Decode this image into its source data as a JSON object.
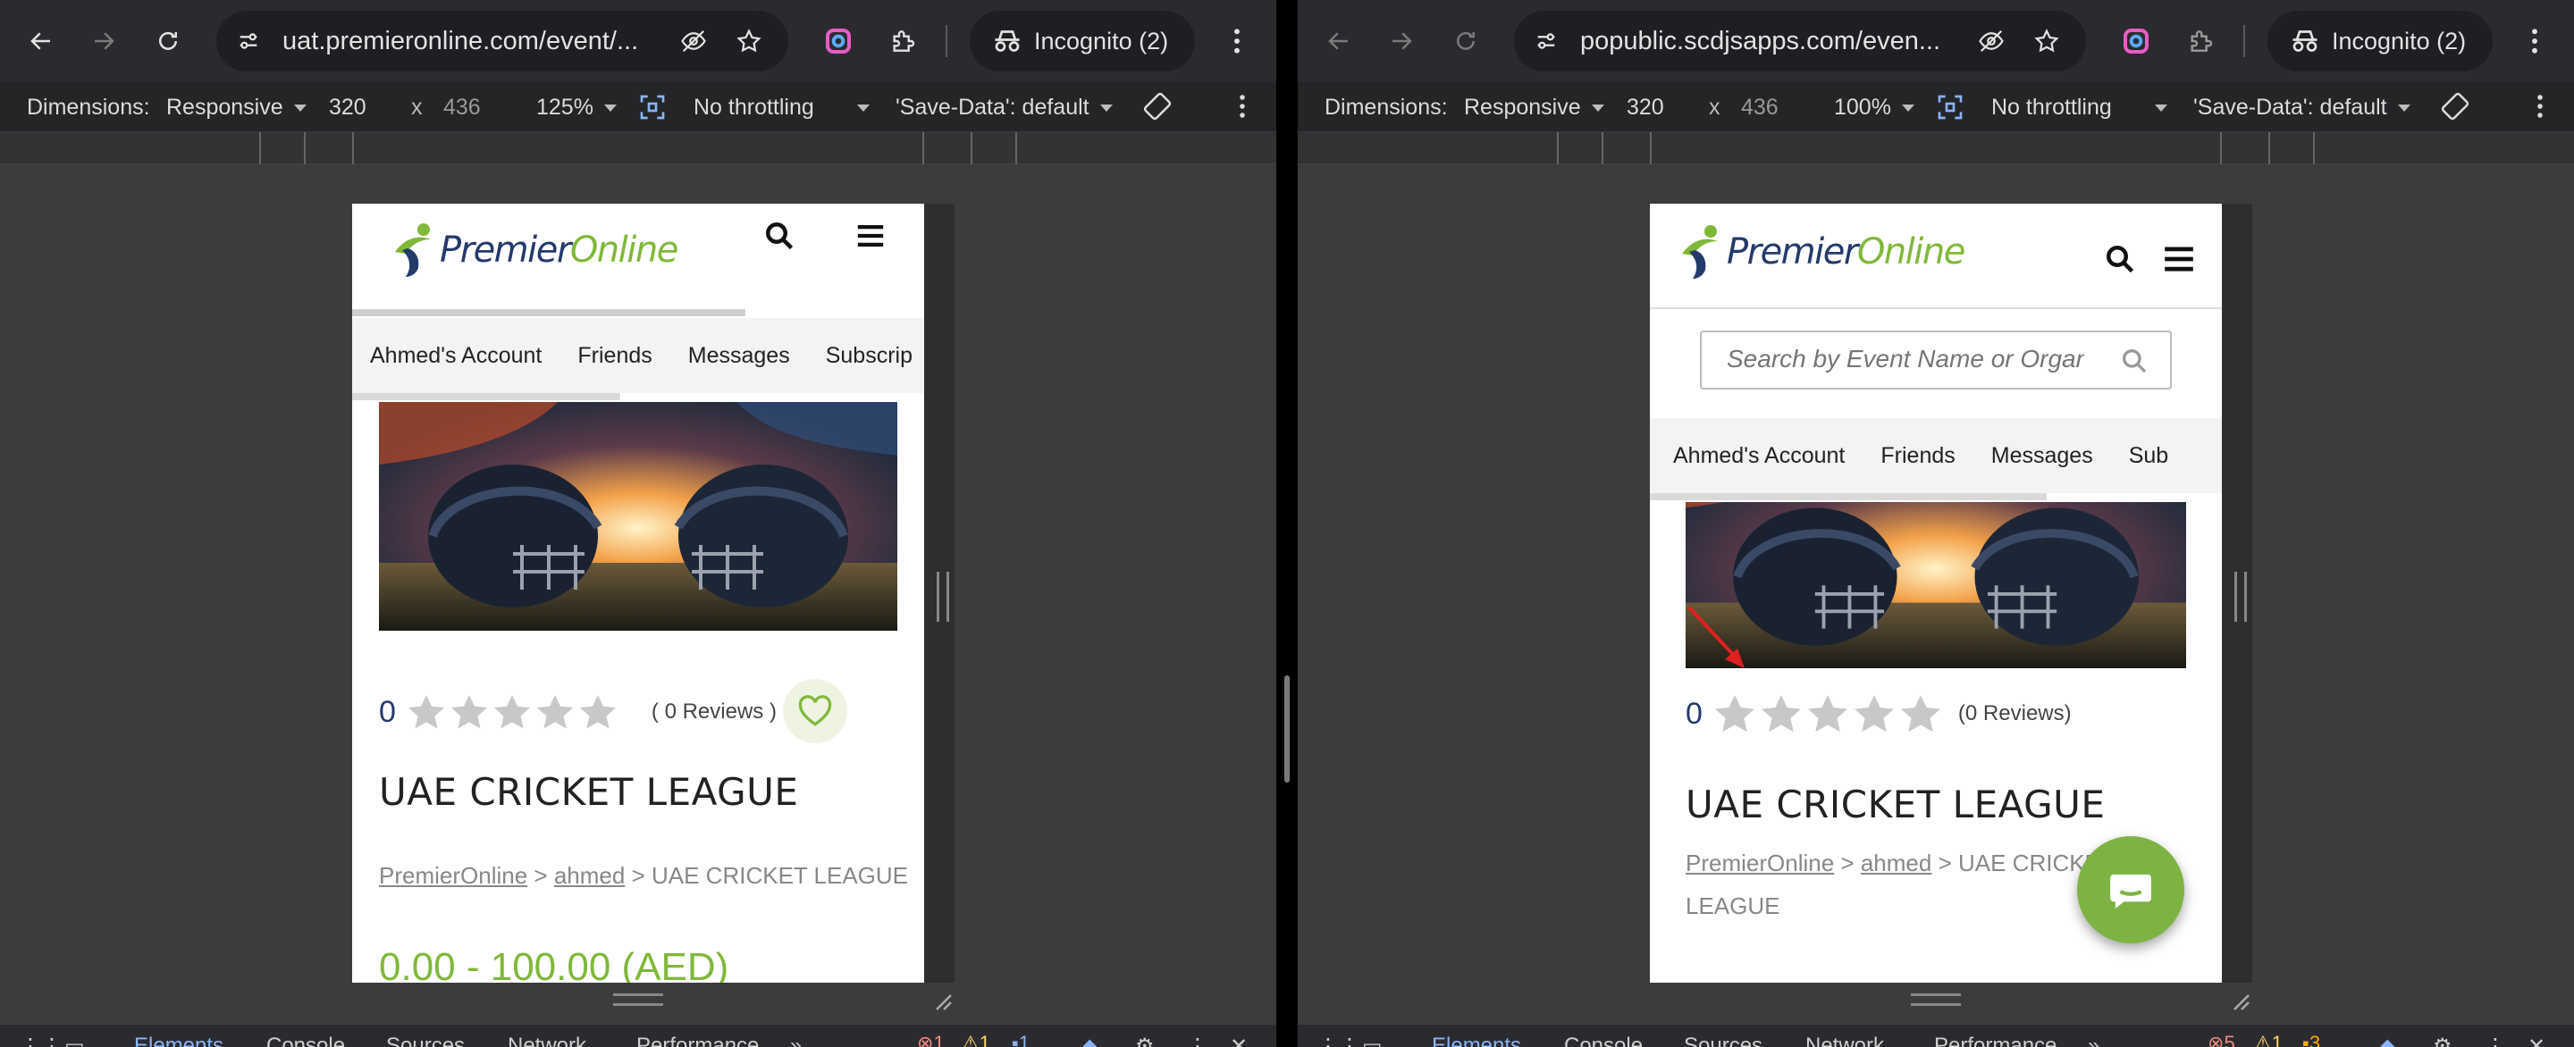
{
  "left": {
    "url": "uat.premieronline.com/event/...",
    "incognito_label": "Incognito (2)",
    "devbar": {
      "dimensions_label": "Dimensions:",
      "device": "Responsive",
      "width": "320",
      "times": "x",
      "height": "436",
      "zoom": "125%",
      "throttle": "No throttling",
      "save_data": "'Save-Data': default"
    },
    "page": {
      "logo_part1": "Premier",
      "logo_part2": "Online",
      "nav": [
        "Ahmed's Account",
        "Friends",
        "Messages",
        "Subscrip"
      ],
      "rating_value": "0",
      "reviews": "( 0 Reviews )",
      "title": "UAE CRICKET LEAGUE",
      "crumb_home": "PremierOnline",
      "crumb_sep": ">",
      "crumb_user": "ahmed",
      "crumb_current": "UAE CRICKET LEAGUE",
      "price": "0.00 - 100.00 (AED)"
    },
    "bottom": {
      "tabs": [
        "Elements",
        "Console",
        "Sources",
        "Network",
        "Performance",
        "»"
      ],
      "errors": "1",
      "warnings": "1",
      "info": "1"
    }
  },
  "right": {
    "url": "popublic.scdjsapps.com/even...",
    "incognito_label": "Incognito (2)",
    "devbar": {
      "dimensions_label": "Dimensions:",
      "device": "Responsive",
      "width": "320",
      "times": "x",
      "height": "436",
      "zoom": "100%",
      "throttle": "No throttling",
      "save_data": "'Save-Data': default"
    },
    "page": {
      "logo_part1": "Premier",
      "logo_part2": "Online",
      "search_placeholder": "Search by Event Name or Organizer",
      "nav": [
        "Ahmed's Account",
        "Friends",
        "Messages",
        "Sub"
      ],
      "rating_value": "0",
      "reviews": "(0 Reviews)",
      "title": "UAE CRICKET LEAGUE",
      "crumb_home": "PremierOnline",
      "crumb_sep": ">",
      "crumb_user": "ahmed",
      "crumb_current": "UAE CRICKET LEAGUE"
    },
    "bottom": {
      "tabs": [
        "Elements",
        "Console",
        "Sources",
        "Network",
        "Performance",
        "»"
      ],
      "errors": "5",
      "warnings": "1",
      "info": "3"
    }
  },
  "colors": {
    "brand_blue": "#243a6b",
    "brand_green": "#80b83a",
    "annotation_red": "#e02020",
    "devtools_active": "#8ab4f8"
  }
}
